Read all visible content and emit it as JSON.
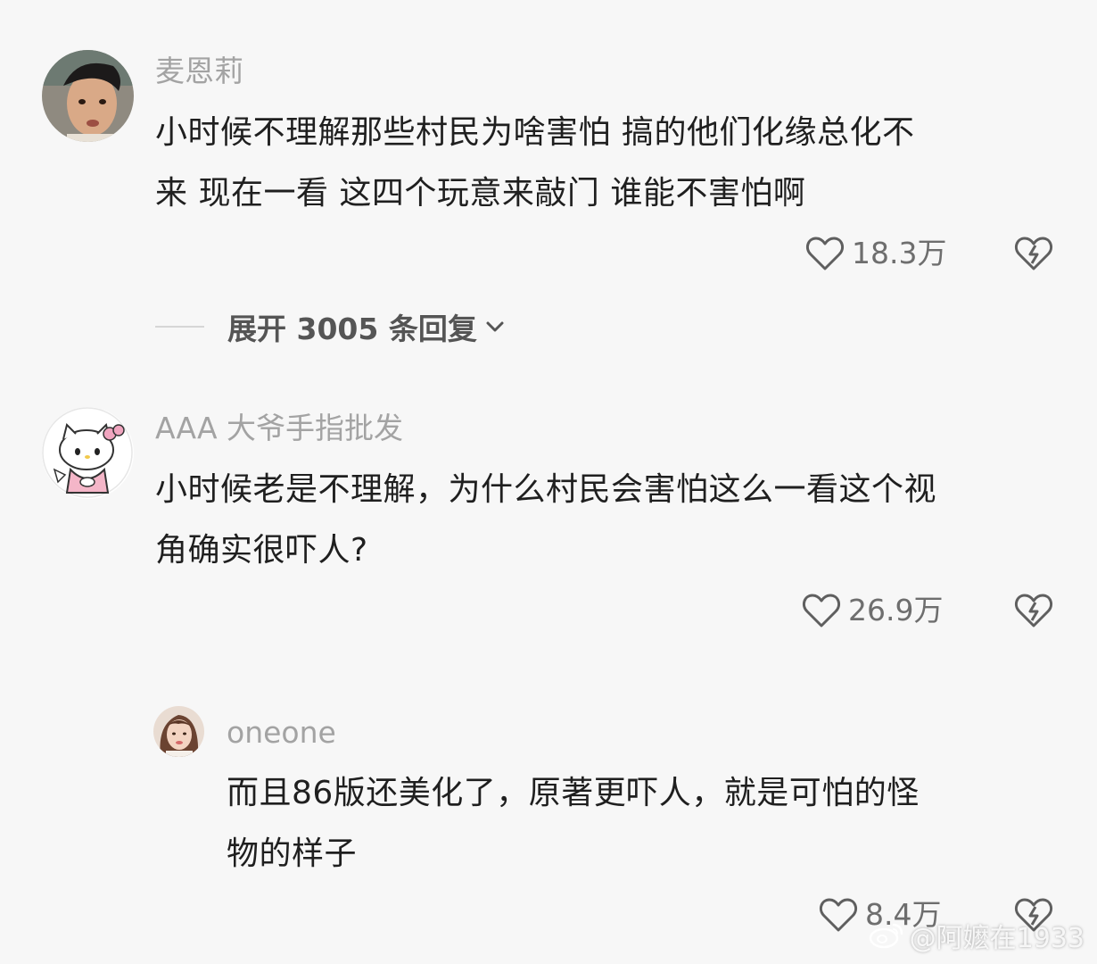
{
  "comments": [
    {
      "username": "麦恩莉",
      "text_lines": [
        "小时候不理解那些村民为啥害怕 搞的他们化缘总化不",
        "来 现在一看 这四个玩意来敲门 谁能不害怕啊"
      ],
      "likes": "18.3万",
      "replies_label": "展开 3005 条回复",
      "avatar_icon": "person-avatar"
    },
    {
      "username": "AAA 大爷手指批发",
      "text_lines": [
        "小时候老是不理解，为什么村民会害怕这么一看这个视",
        "角确实很吓人?"
      ],
      "likes": "26.9万",
      "avatar_icon": "hello-kitty-avatar"
    },
    {
      "username": "oneone",
      "text_lines": [
        "而且86版还美化了，原著更吓人，就是可怕的怪",
        "物的样子"
      ],
      "likes": "8.4万",
      "avatar_icon": "woman-avatar"
    }
  ],
  "watermark": {
    "text": "@阿嬷在1933"
  },
  "colors": {
    "background": "#f7f7f7",
    "username": "#a3a3a3",
    "text": "#1f1f1f",
    "count": "#6e6e6e"
  }
}
